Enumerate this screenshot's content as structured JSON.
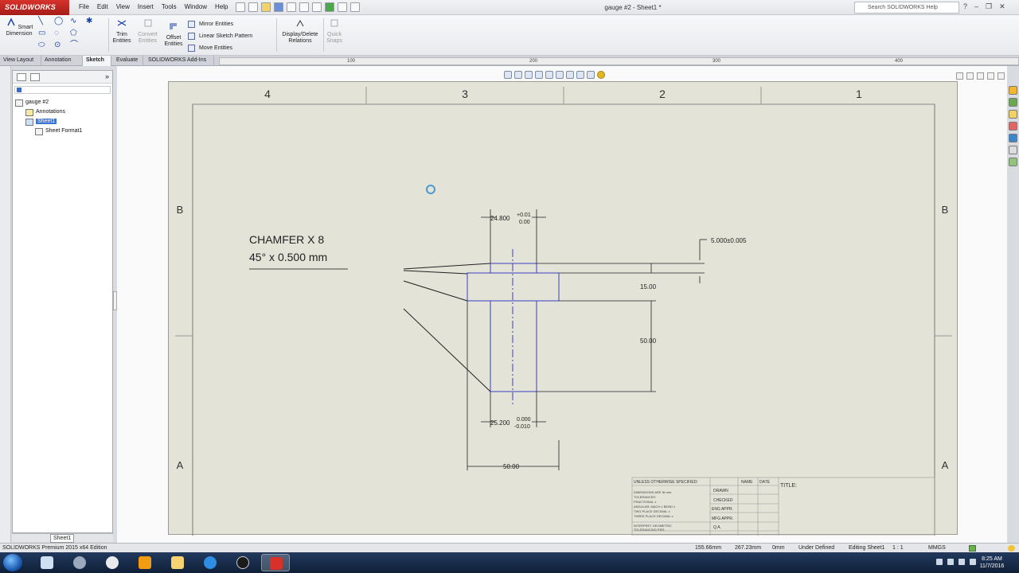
{
  "app": {
    "logo": "SOLIDWORKS",
    "document_title": "gauge #2 - Sheet1 *",
    "search_placeholder": "Search SOLIDWORKS Help"
  },
  "menu": [
    "File",
    "Edit",
    "View",
    "Insert",
    "Tools",
    "Window",
    "Help"
  ],
  "command_manager": {
    "smart_dimension": "Smart Dimension",
    "trim_entities": "Trim Entities",
    "convert_entities": "Convert Entities",
    "offset_entities": "Offset Entities",
    "mirror_entities": "Mirror Entities",
    "linear_sketch_pattern": "Linear Sketch Pattern",
    "move_entities": "Move Entities",
    "display_delete_relations": "Display/Delete Relations",
    "quick_snaps": "Quick Snaps"
  },
  "tabs": [
    "View Layout",
    "Annotation",
    "Sketch",
    "Evaluate",
    "SOLIDWORKS Add-Ins"
  ],
  "active_tab": "Sketch",
  "ruler": [
    "100",
    "200",
    "300",
    "400"
  ],
  "tree": {
    "root": "gauge #2",
    "annotations": "Annotations",
    "sheet": "Sheet1",
    "sheet_format": "Sheet Format1"
  },
  "sheet_tab": "Sheet1",
  "drawing": {
    "zones_top": [
      "4",
      "3",
      "2",
      "1"
    ],
    "zones_side": [
      "B",
      "A"
    ],
    "note_line1": "CHAMFER X 8",
    "note_line2": "45°  x  0.500 mm",
    "dim_top_value": "24.800",
    "dim_top_tol_plus": "+0.01",
    "dim_top_tol_minus": "0.00",
    "dim_right_tol": "5.000±0.005",
    "dim_15": "15.00",
    "dim_50_vert": "50.00",
    "dim_bottom_value": "25.200",
    "dim_bottom_tol_plus": "0.000",
    "dim_bottom_tol_minus": "-0.010",
    "dim_50_horiz": "50.00",
    "titleblock": {
      "unless": "UNLESS OTHERWISE SPECIFIED:",
      "name": "NAME",
      "date": "DATE",
      "title": "TITLE:",
      "drawn": "DRAWN",
      "checked": "CHECKED",
      "eng_appr": "ENG APPR.",
      "mfg_appr": "MFG APPR.",
      "qa": "Q.A.",
      "notes": [
        "DIMENSIONS ARE IN mm",
        "TOLERANCES:",
        "FRACTIONAL ±",
        "ANGULAR: MACH ±    BEND ±",
        "TWO PLACE DECIMAL    ±",
        "THREE PLACE DECIMAL  ±"
      ],
      "interpret": "INTERPRET GEOMETRIC",
      "tolerancing": "TOLERANCING PER:"
    }
  },
  "status": {
    "edition": "SOLIDWORKS Premium 2015 x64 Edition",
    "x": "155.66mm",
    "y": "267.23mm",
    "z": "0mm",
    "state": "Under Defined",
    "editing": "Editing Sheet1",
    "scale": "1 : 1",
    "units": "MMGS"
  },
  "clock": {
    "time": "8:25 AM",
    "date": "11/7/2016"
  }
}
